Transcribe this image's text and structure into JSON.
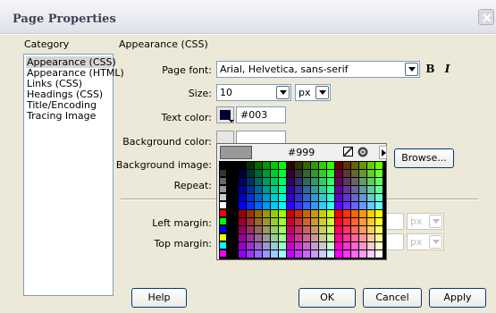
{
  "window": {
    "title": "Page Properties"
  },
  "category": {
    "label": "Category",
    "items": [
      "Appearance (CSS)",
      "Appearance (HTML)",
      "Links (CSS)",
      "Headings (CSS)",
      "Title/Encoding",
      "Tracing Image"
    ],
    "selected": "Appearance (CSS)"
  },
  "section": {
    "title": "Appearance (CSS)"
  },
  "fields": {
    "page_font": {
      "label": "Page font:",
      "value": "Arial, Helvetica, sans-serif"
    },
    "size": {
      "label": "Size:",
      "value": "10",
      "unit": "px"
    },
    "text_color": {
      "label": "Text color:",
      "value": "#003",
      "swatch": "#000033"
    },
    "background_color": {
      "label": "Background color:",
      "value": ""
    },
    "background_image": {
      "label": "Background image:"
    },
    "repeat": {
      "label": "Repeat:"
    },
    "left_margin": {
      "label": "Left margin:",
      "unit": "px"
    },
    "top_margin": {
      "label": "Top margin:",
      "unit": "px"
    }
  },
  "format_buttons": {
    "bold": "B",
    "italic": "I"
  },
  "color_picker": {
    "hex": "#999",
    "preview": "#999999",
    "no_color_icon": "no-color-icon",
    "system_color_icon": "system-color-icon"
  },
  "buttons": {
    "browse": "Browse...",
    "help": "Help",
    "ok": "OK",
    "cancel": "Cancel",
    "apply": "Apply"
  },
  "colors": {
    "selection": "#d5d5d5",
    "dialog": "#ece9d8",
    "border": "#7f9db9"
  }
}
